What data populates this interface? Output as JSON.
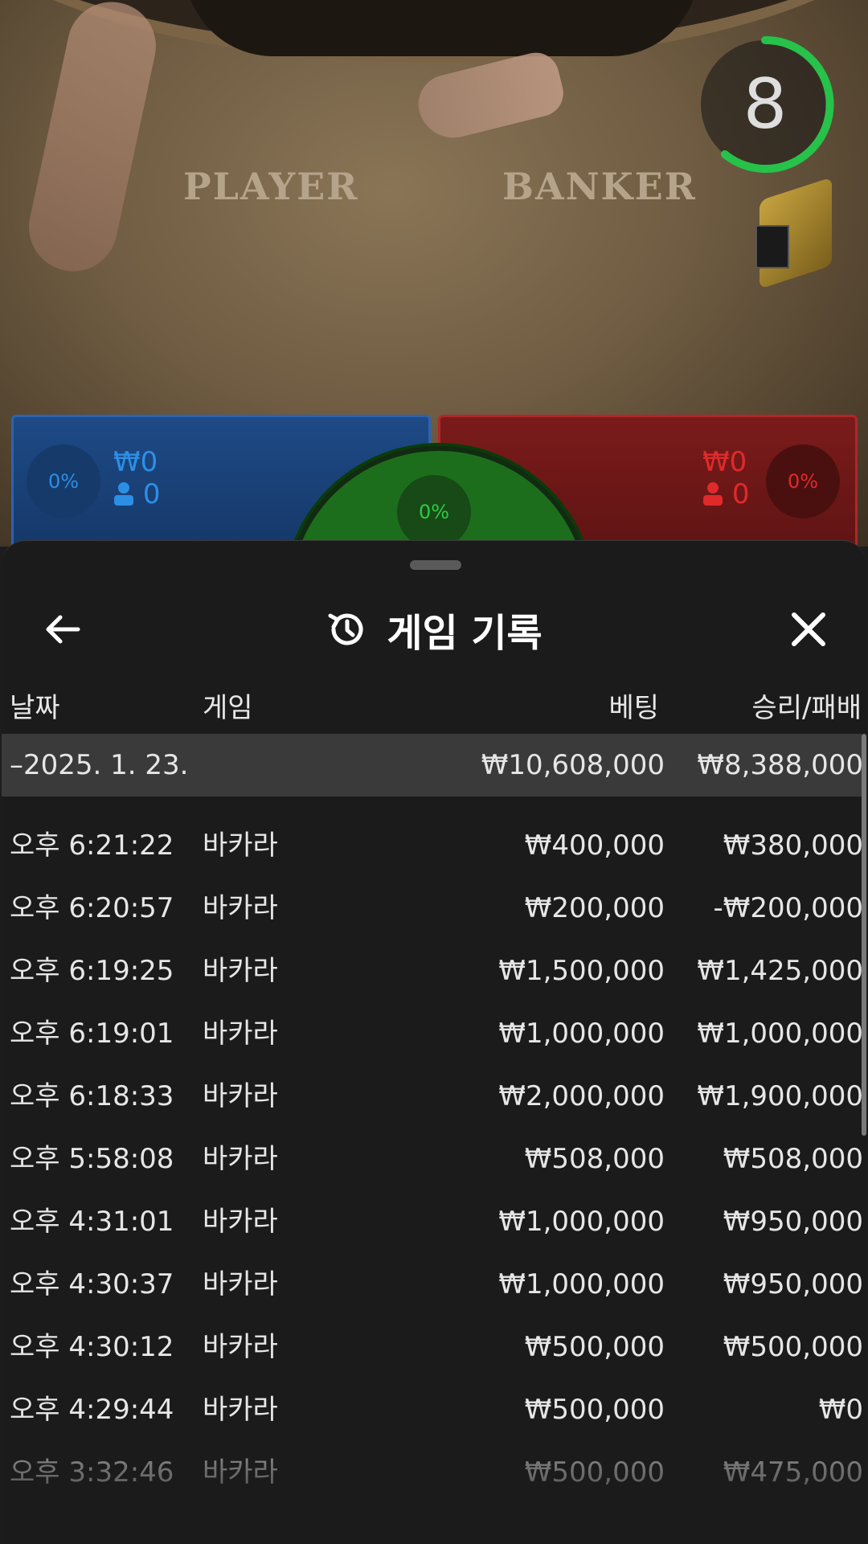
{
  "video": {
    "felt_player": "PLAYER",
    "felt_banker": "BANKER",
    "timer": "8"
  },
  "bets": {
    "player": {
      "percent": "0%",
      "amount": "₩0",
      "players": "0",
      "color": "#2c8fe6"
    },
    "tie": {
      "percent": "0%",
      "color": "#2ecc40"
    },
    "banker": {
      "percent": "0%",
      "amount": "₩0",
      "players": "0",
      "color": "#e02a2a"
    }
  },
  "sheet": {
    "title": "게임 기록",
    "back_icon": "arrow-left-icon",
    "history_icon": "history-icon",
    "close_icon": "close-icon",
    "columns": {
      "date": "날짜",
      "game": "게임",
      "bet": "베팅",
      "winloss": "승리/패배"
    },
    "group": {
      "date": "–2025. 1. 23.",
      "bet": "₩10,608,000",
      "winloss": "₩8,388,000"
    },
    "rows": [
      {
        "time": "오후 6:21:22",
        "game": "바카라",
        "bet": "₩400,000",
        "winloss": "₩380,000"
      },
      {
        "time": "오후 6:20:57",
        "game": "바카라",
        "bet": "₩200,000",
        "winloss": "-₩200,000"
      },
      {
        "time": "오후 6:19:25",
        "game": "바카라",
        "bet": "₩1,500,000",
        "winloss": "₩1,425,000"
      },
      {
        "time": "오후 6:19:01",
        "game": "바카라",
        "bet": "₩1,000,000",
        "winloss": "₩1,000,000"
      },
      {
        "time": "오후 6:18:33",
        "game": "바카라",
        "bet": "₩2,000,000",
        "winloss": "₩1,900,000"
      },
      {
        "time": "오후 5:58:08",
        "game": "바카라",
        "bet": "₩508,000",
        "winloss": "₩508,000"
      },
      {
        "time": "오후 4:31:01",
        "game": "바카라",
        "bet": "₩1,000,000",
        "winloss": "₩950,000"
      },
      {
        "time": "오후 4:30:37",
        "game": "바카라",
        "bet": "₩1,000,000",
        "winloss": "₩950,000"
      },
      {
        "time": "오후 4:30:12",
        "game": "바카라",
        "bet": "₩500,000",
        "winloss": "₩500,000"
      },
      {
        "time": "오후 4:29:44",
        "game": "바카라",
        "bet": "₩500,000",
        "winloss": "₩0"
      },
      {
        "time": "오후 3:32:46",
        "game": "바카라",
        "bet": "₩500,000",
        "winloss": "₩475,000"
      }
    ]
  }
}
